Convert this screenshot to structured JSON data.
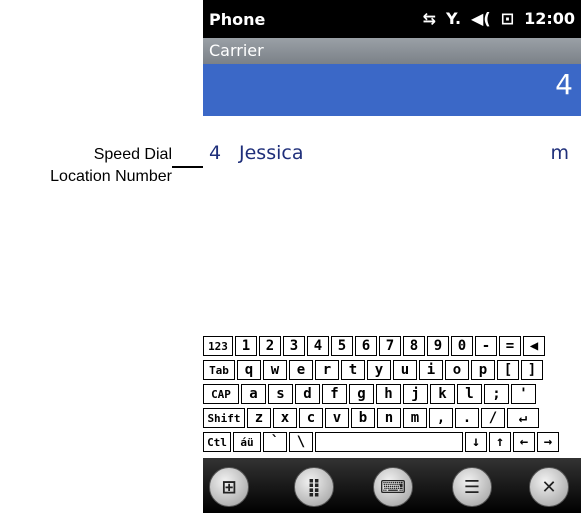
{
  "annotation": {
    "line1": "Speed Dial",
    "line2": "Location Number"
  },
  "status": {
    "app_title": "Phone",
    "time": "12:00",
    "icons": [
      "sync-icon",
      "signal-icon",
      "volume-icon",
      "battery-icon"
    ]
  },
  "carrier": {
    "label": "Carrier"
  },
  "dial": {
    "number": "4"
  },
  "contact": {
    "index": "4",
    "name": "Jessica",
    "type": "m"
  },
  "keyboard": {
    "row1": [
      "123",
      "1",
      "2",
      "3",
      "4",
      "5",
      "6",
      "7",
      "8",
      "9",
      "0",
      "-",
      "=",
      "◀"
    ],
    "row2": [
      "Tab",
      "q",
      "w",
      "e",
      "r",
      "t",
      "y",
      "u",
      "i",
      "o",
      "p",
      "[",
      "]"
    ],
    "row3": [
      "CAP",
      "a",
      "s",
      "d",
      "f",
      "g",
      "h",
      "j",
      "k",
      "l",
      ";",
      "'"
    ],
    "row4": [
      "Shift",
      "z",
      "x",
      "c",
      "v",
      "b",
      "n",
      "m",
      ",",
      ".",
      "/",
      "↵"
    ],
    "row5": [
      "Ctl",
      "áü",
      "`",
      "\\",
      "",
      "↓",
      "↑",
      "←",
      "→"
    ]
  },
  "softbar": {
    "buttons": [
      "windows-start-icon",
      "dialpad-icon",
      "keyboard-icon",
      "menu-icon",
      "close-icon"
    ]
  }
}
